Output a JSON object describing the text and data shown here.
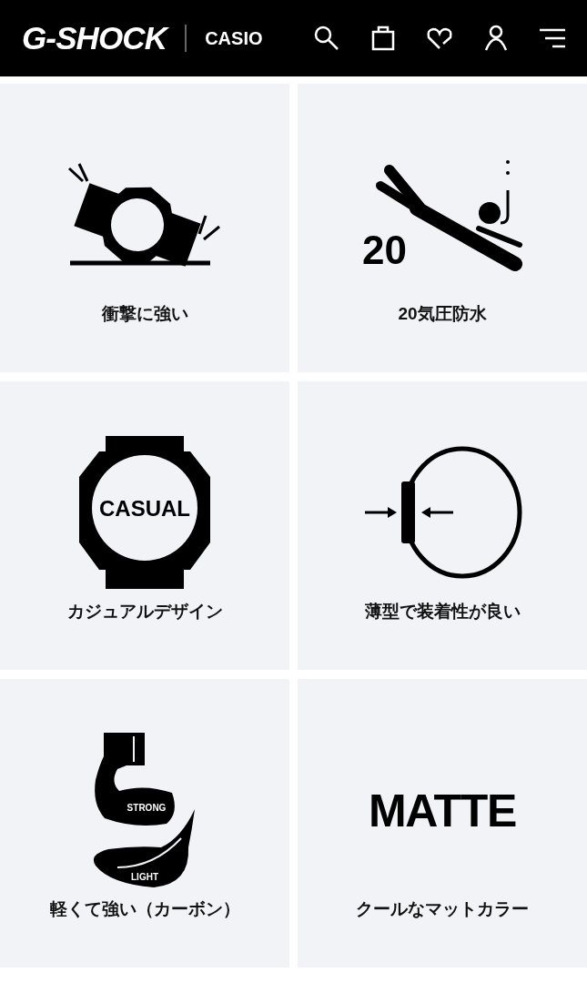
{
  "header": {
    "logo": "G-SHOCK",
    "brand": "CASIO"
  },
  "features": [
    {
      "kind": "impact",
      "label": "衝撃に強い"
    },
    {
      "kind": "water",
      "label": "20気圧防水",
      "icon_text": "20"
    },
    {
      "kind": "casual",
      "label": "カジュアルデザイン",
      "icon_text": "CASUAL"
    },
    {
      "kind": "slim",
      "label": "薄型で装着性が良い"
    },
    {
      "kind": "carbon",
      "label": "軽くて強い（カーボン）",
      "icon_texts": [
        "STRONG",
        "LIGHT"
      ]
    },
    {
      "kind": "matte",
      "label": "クールなマットカラー",
      "icon_text": "MATTE"
    }
  ]
}
